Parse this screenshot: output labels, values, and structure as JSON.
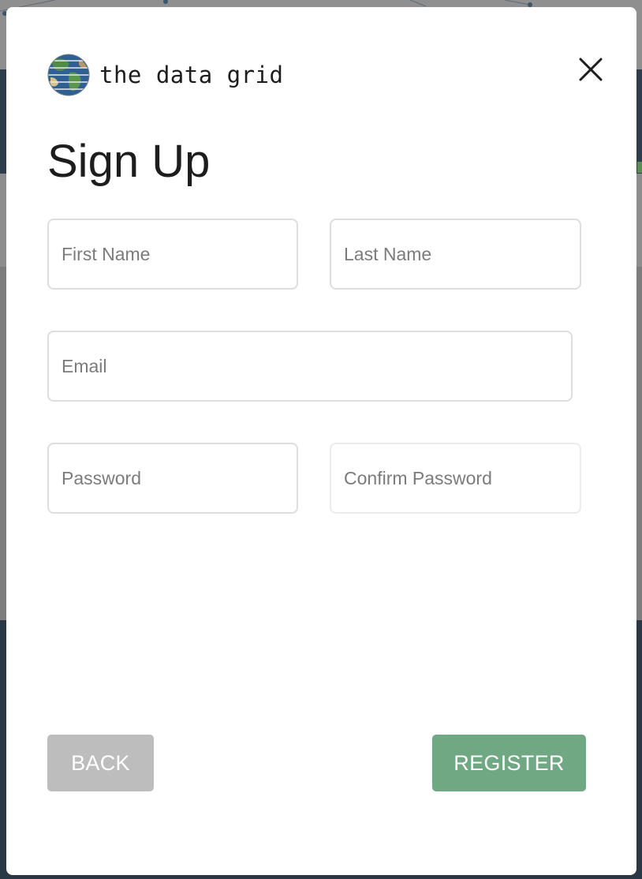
{
  "brand": {
    "name": "the data grid",
    "logo_icon": "globe-icon"
  },
  "modal": {
    "title": "Sign Up",
    "close_icon": "close-icon"
  },
  "form": {
    "first_name": {
      "placeholder": "First Name",
      "value": ""
    },
    "last_name": {
      "placeholder": "Last Name",
      "value": ""
    },
    "email": {
      "placeholder": "Email",
      "value": ""
    },
    "password": {
      "placeholder": "Password",
      "value": ""
    },
    "confirm_password": {
      "placeholder": "Confirm Password",
      "value": ""
    }
  },
  "actions": {
    "back_label": "BACK",
    "register_label": "REGISTER"
  },
  "colors": {
    "register": "#70a884",
    "back": "#bdbdbd",
    "text": "#1d1d1d",
    "overlay": "#6a6a6a"
  }
}
